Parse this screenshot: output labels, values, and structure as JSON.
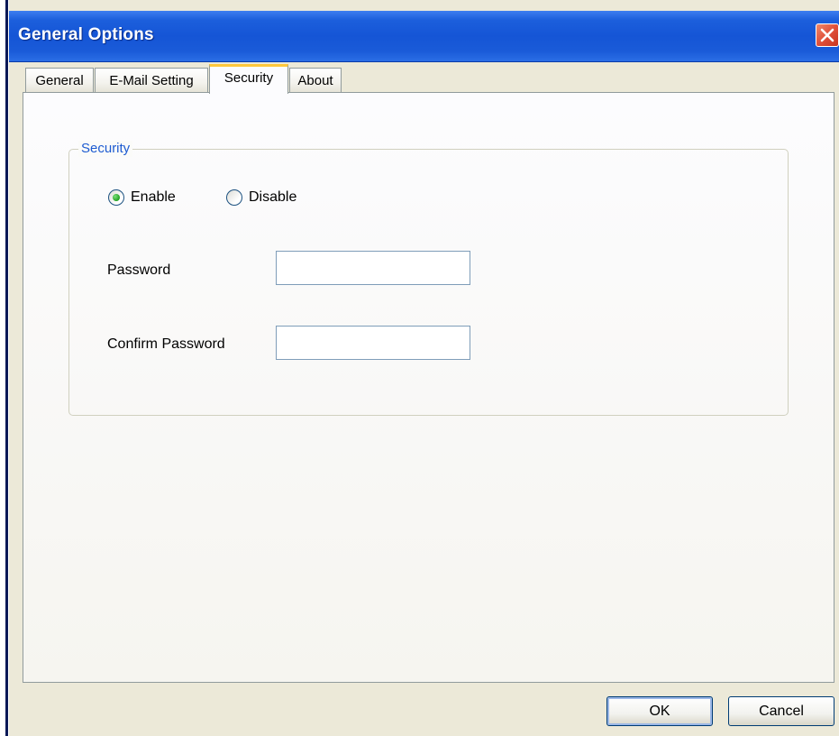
{
  "window": {
    "title": "General Options"
  },
  "tabs": [
    {
      "label": "General",
      "active": false
    },
    {
      "label": "E-Mail Setting",
      "active": false
    },
    {
      "label": "Security",
      "active": true
    },
    {
      "label": "About",
      "active": false
    }
  ],
  "security": {
    "group_title": "Security",
    "enable_label": "Enable",
    "disable_label": "Disable",
    "selected": "Enable",
    "password_label": "Password",
    "password_value": "",
    "confirm_label": "Confirm Password",
    "confirm_value": ""
  },
  "buttons": {
    "ok_label": "OK",
    "cancel_label": "Cancel"
  },
  "icons": {
    "close": "close-icon"
  },
  "colors": {
    "titlebar": "#1555d6",
    "close_button": "#e0503a",
    "active_tab_accent": "#ffc83c",
    "group_title": "#1d5bd1",
    "dialog_background": "#ece9d8"
  }
}
